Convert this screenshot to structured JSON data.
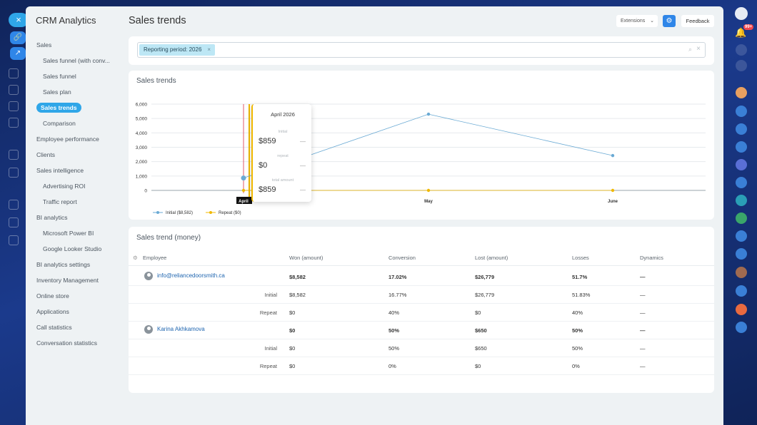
{
  "page": {
    "title": "Sales trends"
  },
  "sidebar": {
    "title": "CRM Analytics",
    "items": [
      {
        "label": "Sales",
        "sub": false
      },
      {
        "label": "Sales funnel (with conv...",
        "sub": true
      },
      {
        "label": "Sales funnel",
        "sub": true
      },
      {
        "label": "Sales plan",
        "sub": true
      },
      {
        "label": "Sales trends",
        "sub": true,
        "active": true
      },
      {
        "label": "Comparison",
        "sub": true
      },
      {
        "label": "Employee performance",
        "sub": false
      },
      {
        "label": "Clients",
        "sub": false
      },
      {
        "label": "Sales intelligence",
        "sub": false
      },
      {
        "label": "Advertising ROI",
        "sub": true
      },
      {
        "label": "Traffic report",
        "sub": true
      },
      {
        "label": "BI analytics",
        "sub": false
      },
      {
        "label": "Microsoft Power BI",
        "sub": true
      },
      {
        "label": "Google Looker Studio",
        "sub": true
      },
      {
        "label": "BI analytics settings",
        "sub": false
      },
      {
        "label": "Inventory Management",
        "sub": false
      },
      {
        "label": "Online store",
        "sub": false
      },
      {
        "label": "Applications",
        "sub": false
      },
      {
        "label": "Call statistics",
        "sub": false
      },
      {
        "label": "Conversation statistics",
        "sub": false
      }
    ]
  },
  "toolbar": {
    "extensions_label": "Extensions",
    "feedback_label": "Feedback"
  },
  "filter": {
    "chip_label": "Reporting period: 2026"
  },
  "rail": {
    "badge": "99+"
  },
  "chart_card": {
    "title": "Sales trends"
  },
  "tooltip": {
    "title": "April 2026",
    "initial_label": "Initial",
    "initial_value": "$859",
    "repeat_label": "repeat",
    "repeat_value": "$0",
    "total_label": "total amount",
    "total_value": "$859",
    "dash": "—"
  },
  "chart_data": {
    "type": "line",
    "categories": [
      "April",
      "May",
      "June"
    ],
    "series": [
      {
        "name": "Initial ($8,582)",
        "values": [
          859,
          5300,
          2423
        ],
        "color": "#6aaad4"
      },
      {
        "name": "Repeat ($0)",
        "values": [
          0,
          0,
          0
        ],
        "color": "#f0b800"
      }
    ],
    "yticks": [
      "6,000",
      "5,000",
      "4,000",
      "3,000",
      "2,000",
      "1,000",
      "0"
    ],
    "ylim": [
      0,
      6000
    ],
    "grid": true,
    "legend": "bottom-left"
  },
  "table": {
    "title": "Sales trend (money)",
    "columns": [
      "Employee",
      "Won (amount)",
      "Conversion",
      "Lost (amount)",
      "Losses",
      "Dynamics"
    ],
    "rows": [
      {
        "employee": "info@reliancedoorsmith.ca",
        "sub": "",
        "won": "$8,582",
        "conv": "17.02%",
        "lost": "$26,779",
        "losses": "51.7%",
        "dyn": "—",
        "bold": true
      },
      {
        "employee": "",
        "sub": "Initial",
        "won": "$8,582",
        "conv": "16.77%",
        "lost": "$26,779",
        "losses": "51.83%",
        "dyn": "—",
        "bold": false
      },
      {
        "employee": "",
        "sub": "Repeat",
        "won": "$0",
        "conv": "40%",
        "lost": "$0",
        "losses": "40%",
        "dyn": "—",
        "bold": false
      },
      {
        "employee": "Karina Akhkamova",
        "sub": "",
        "won": "$0",
        "conv": "50%",
        "lost": "$650",
        "losses": "50%",
        "dyn": "—",
        "bold": true
      },
      {
        "employee": "",
        "sub": "Initial",
        "won": "$0",
        "conv": "50%",
        "lost": "$650",
        "losses": "50%",
        "dyn": "—",
        "bold": false
      },
      {
        "employee": "",
        "sub": "Repeat",
        "won": "$0",
        "conv": "0%",
        "lost": "$0",
        "losses": "0%",
        "dyn": "—",
        "bold": false
      }
    ]
  }
}
